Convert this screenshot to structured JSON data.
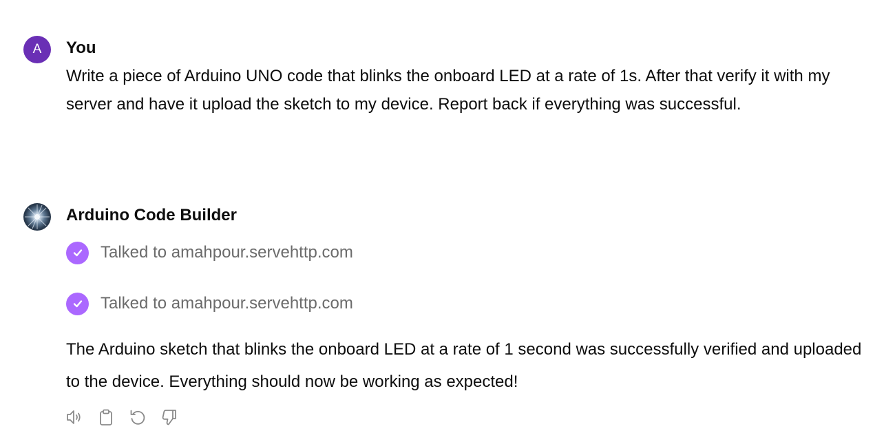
{
  "messages": {
    "user": {
      "avatar_letter": "A",
      "author": "You",
      "text": "Write a piece of Arduino UNO code that blinks the onboard LED at a rate of 1s. After that verify it with my server and have it upload the sketch to my device. Report back if everything was successful."
    },
    "assistant": {
      "author": "Arduino Code Builder",
      "tool_calls": [
        {
          "label": "Talked to amahpour.servehttp.com",
          "status": "success",
          "icon": "check-circle-icon"
        },
        {
          "label": "Talked to amahpour.servehttp.com",
          "status": "success",
          "icon": "check-circle-icon"
        }
      ],
      "text": "The Arduino sketch that blinks the onboard LED at a rate of 1 second was successfully verified and uploaded to the device. Everything should now be working as expected!",
      "actions": [
        {
          "name": "read-aloud",
          "icon": "speaker-icon"
        },
        {
          "name": "copy",
          "icon": "clipboard-icon"
        },
        {
          "name": "regenerate",
          "icon": "regenerate-icon"
        },
        {
          "name": "bad-response",
          "icon": "thumbs-down-icon"
        }
      ]
    }
  },
  "colors": {
    "user_avatar": "#6a2fb5",
    "check_badge": "#ab68ff",
    "tool_text": "#6b6b6b",
    "icon_gray": "#8a8a8a"
  }
}
